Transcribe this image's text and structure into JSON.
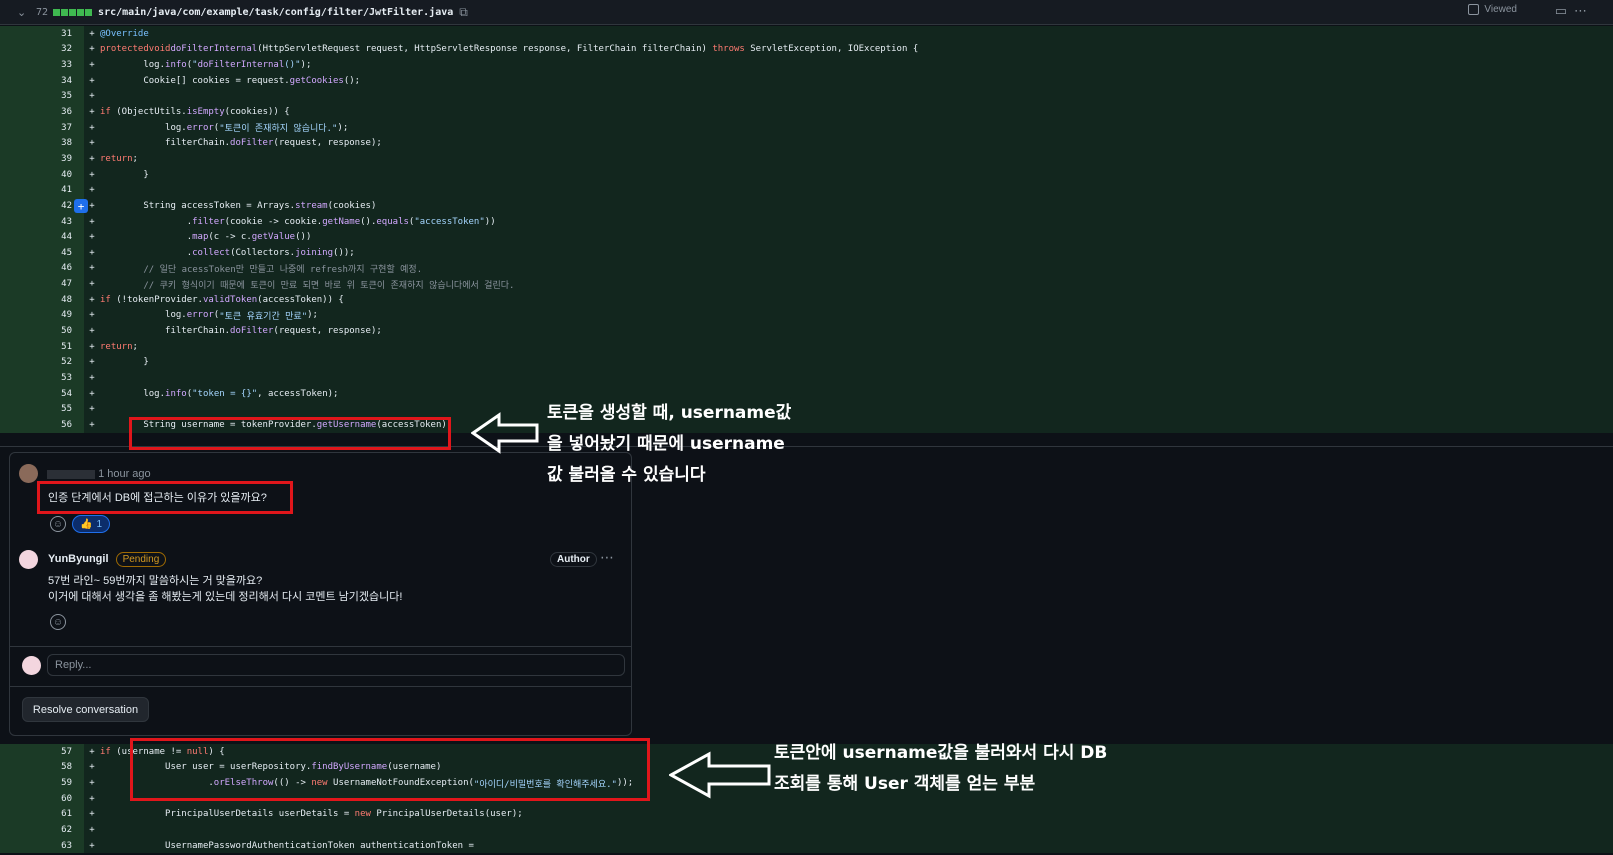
{
  "file": {
    "changes": "72",
    "path": "src/main/java/com/example/task/config/filter/JwtFilter.java",
    "viewed_label": "Viewed"
  },
  "code_top": [
    {
      "n": "31",
      "t": "    @Override"
    },
    {
      "n": "32",
      "t": "    protected void doFilterInternal(HttpServletRequest request, HttpServletResponse response, FilterChain filterChain) throws ServletException, IOException {"
    },
    {
      "n": "33",
      "t": "        log.info(\"doFilterInternal()\");"
    },
    {
      "n": "34",
      "t": "        Cookie[] cookies = request.getCookies();"
    },
    {
      "n": "35",
      "t": ""
    },
    {
      "n": "36",
      "t": "        if (ObjectUtils.isEmpty(cookies)) {"
    },
    {
      "n": "37",
      "t": "            log.error(\"토큰이 존재하지 않습니다.\");"
    },
    {
      "n": "38",
      "t": "            filterChain.doFilter(request, response);"
    },
    {
      "n": "39",
      "t": "            return;"
    },
    {
      "n": "40",
      "t": "        }"
    },
    {
      "n": "41",
      "t": ""
    },
    {
      "n": "42",
      "t": "        String accessToken = Arrays.stream(cookies)"
    },
    {
      "n": "43",
      "t": "                .filter(cookie -> cookie.getName().equals(\"accessToken\"))"
    },
    {
      "n": "44",
      "t": "                .map(c -> c.getValue())"
    },
    {
      "n": "45",
      "t": "                .collect(Collectors.joining());"
    },
    {
      "n": "46",
      "t": "        // 일단 acessToken만 만들고 나중에 refresh까지 구현할 예정."
    },
    {
      "n": "47",
      "t": "        // 쿠키 형식이기 때문에 토큰이 만료 되면 바로 위 토큰이 존재하지 않습니다에서 걸린다."
    },
    {
      "n": "48",
      "t": "        if (!tokenProvider.validToken(accessToken)) {"
    },
    {
      "n": "49",
      "t": "            log.error(\"토큰 유효기간 만료\");"
    },
    {
      "n": "50",
      "t": "            filterChain.doFilter(request, response);"
    },
    {
      "n": "51",
      "t": "            return;"
    },
    {
      "n": "52",
      "t": "        }"
    },
    {
      "n": "53",
      "t": ""
    },
    {
      "n": "54",
      "t": "        log.info(\"token = {}\", accessToken);"
    },
    {
      "n": "55",
      "t": ""
    },
    {
      "n": "56",
      "t": "        String username = tokenProvider.getUsername(accessToken);"
    }
  ],
  "code_bottom": [
    {
      "n": "57",
      "t": "        if (username != null) {"
    },
    {
      "n": "58",
      "t": "            User user = userRepository.findByUsername(username)"
    },
    {
      "n": "59",
      "t": "                    .orElseThrow(() -> new UsernameNotFoundException(\"아이디/비밀번호를 확인해주세요.\"));"
    },
    {
      "n": "60",
      "t": ""
    },
    {
      "n": "61",
      "t": "            PrincipalUserDetails userDetails = new PrincipalUserDetails(user);"
    },
    {
      "n": "62",
      "t": ""
    },
    {
      "n": "63",
      "t": "            UsernamePasswordAuthenticationToken authenticationToken ="
    }
  ],
  "conversation": {
    "first_comment": {
      "time": "1 hour ago",
      "body": "인증 단계에서 DB에 접근하는 이유가 있을까요?",
      "reaction_emoji": "👍",
      "reaction_count": "1"
    },
    "second_comment": {
      "author": "YunByungil",
      "status": "Pending",
      "badge": "Author",
      "line1": "57번 라인~ 59번까지 말씀하시는 거 맞을까요?",
      "line2": "이거에 대해서 생각을 좀 해봤는게 있는데 정리해서 다시 코멘트 남기겠습니다!"
    },
    "reply_placeholder": "Reply...",
    "resolve_label": "Resolve conversation"
  },
  "annotations": {
    "note1_line1": "토큰을 생성할 때, username값",
    "note1_line2": "을 넣어놨기 때문에 username",
    "note1_line3": "값 불러올 수 있습니다",
    "note2_line1": "토큰안에 username값을 불러와서 다시 DB",
    "note2_line2": "조회를 통해 User 객체를 얻는 부분"
  },
  "colors": {
    "highlight": "#e0161b",
    "added_line_bg": "#12261e",
    "line_number_bg": "#1b3a26"
  }
}
